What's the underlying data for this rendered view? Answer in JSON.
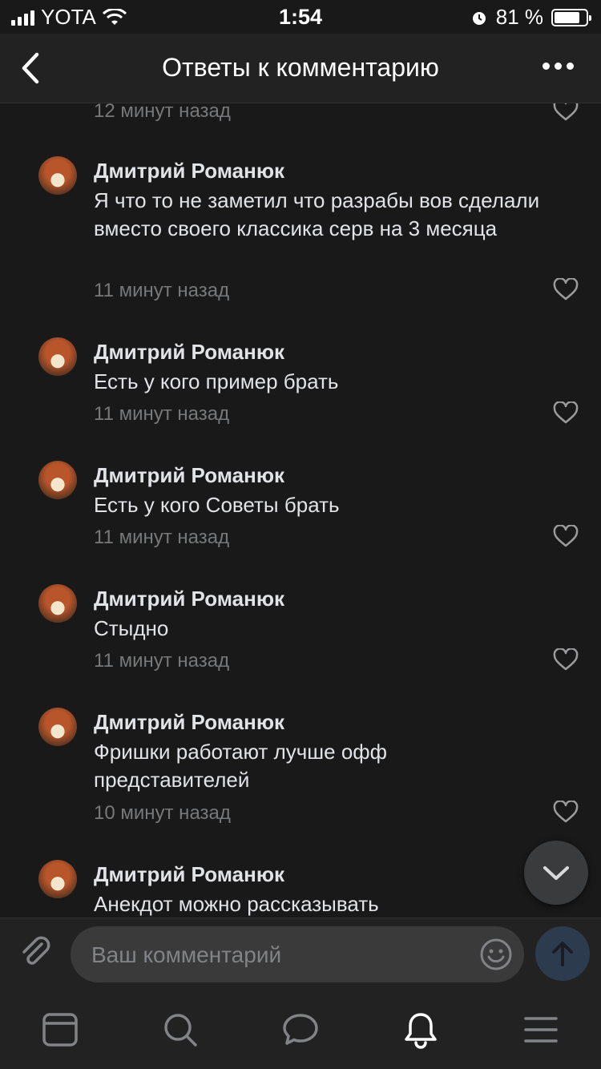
{
  "status": {
    "carrier": "YOTA",
    "time": "1:54",
    "battery_percent": "81 %",
    "battery_level": 0.81
  },
  "header": {
    "title": "Ответы к комментарию"
  },
  "top_partial": {
    "time": "12 минут назад"
  },
  "comments": [
    {
      "author": "Дмитрий Романюк",
      "text": "Я что то не заметил что разрабы вов сделали вместо своего классика серв на 3 месяца",
      "time": "11 минут назад"
    },
    {
      "author": "Дмитрий Романюк",
      "text": "Есть у кого пример брать",
      "time": "11 минут назад"
    },
    {
      "author": "Дмитрий Романюк",
      "text": "Есть у кого Советы брать",
      "time": "11 минут назад"
    },
    {
      "author": "Дмитрий Романюк",
      "text": "Стыдно",
      "time": "11 минут назад"
    },
    {
      "author": "Дмитрий Романюк",
      "text": "Фришки работают лучше офф представителей",
      "time": "10 минут назад"
    },
    {
      "author": "Дмитрий Романюк",
      "text": "Анекдот можно рассказывать",
      "time": ""
    }
  ],
  "composer": {
    "placeholder": "Ваш комментарий"
  },
  "tabs": [
    "news-icon",
    "search-icon",
    "messages-icon",
    "notifications-icon",
    "menu-icon"
  ],
  "colors": {
    "background": "#191919",
    "bar": "#222222",
    "text": "#e1e3e6",
    "secondary": "#76787a",
    "send_button": "#2c3b4e"
  }
}
